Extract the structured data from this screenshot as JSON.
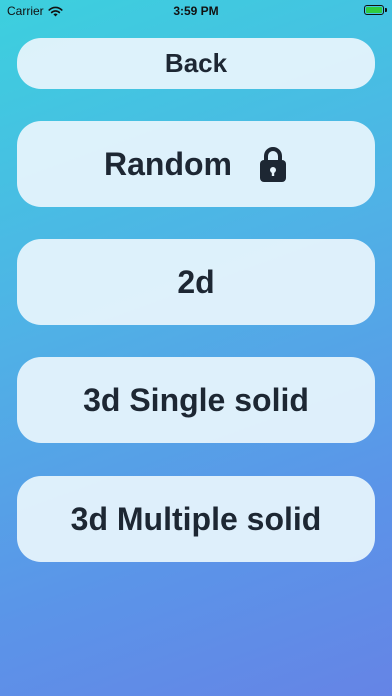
{
  "status_bar": {
    "carrier": "Carrier",
    "time": "3:59 PM",
    "wifi_icon": "wifi-icon",
    "battery_icon": "battery-charging-icon"
  },
  "menu": {
    "back_label": "Back",
    "random_label": "Random",
    "random_locked": true,
    "lock_icon": "lock-icon",
    "two_d_label": "2d",
    "three_d_single_label": "3d Single solid",
    "three_d_multiple_label": "3d Multiple solid"
  },
  "colors": {
    "gradient_top": "#3cd0de",
    "gradient_bottom": "#6584e6",
    "button_bg": "#e7f4fc",
    "button_text": "#1d2733"
  }
}
